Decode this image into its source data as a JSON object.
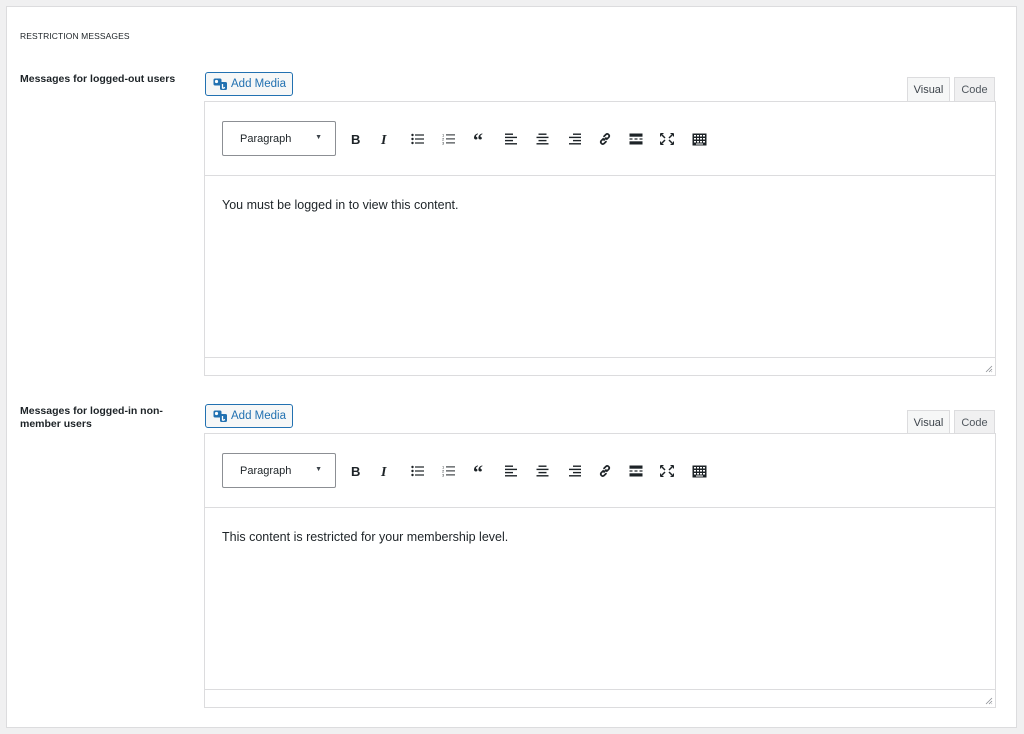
{
  "section": {
    "title": "RESTRICTION MESSAGES"
  },
  "editors": [
    {
      "label": "Messages for logged-out users",
      "add_media": "Add Media",
      "tabs": {
        "visual": "Visual",
        "code": "Code"
      },
      "format": "Paragraph",
      "content": "You must be logged in to view this content."
    },
    {
      "label": "Messages for logged-in non-member users",
      "add_media": "Add Media",
      "tabs": {
        "visual": "Visual",
        "code": "Code"
      },
      "format": "Paragraph",
      "content": "This content is restricted for your membership level."
    }
  ],
  "toolbar_icons": [
    "bold-icon",
    "italic-icon",
    "bulleted-list-icon",
    "numbered-list-icon",
    "blockquote-icon",
    "align-left-icon",
    "align-center-icon",
    "align-right-icon",
    "link-icon",
    "read-more-icon",
    "fullscreen-icon",
    "toolbar-toggle-icon"
  ],
  "colors": {
    "accent": "#2271b1",
    "border": "#dcdcde",
    "text": "#1d2327",
    "background": "#f0f0f1"
  }
}
